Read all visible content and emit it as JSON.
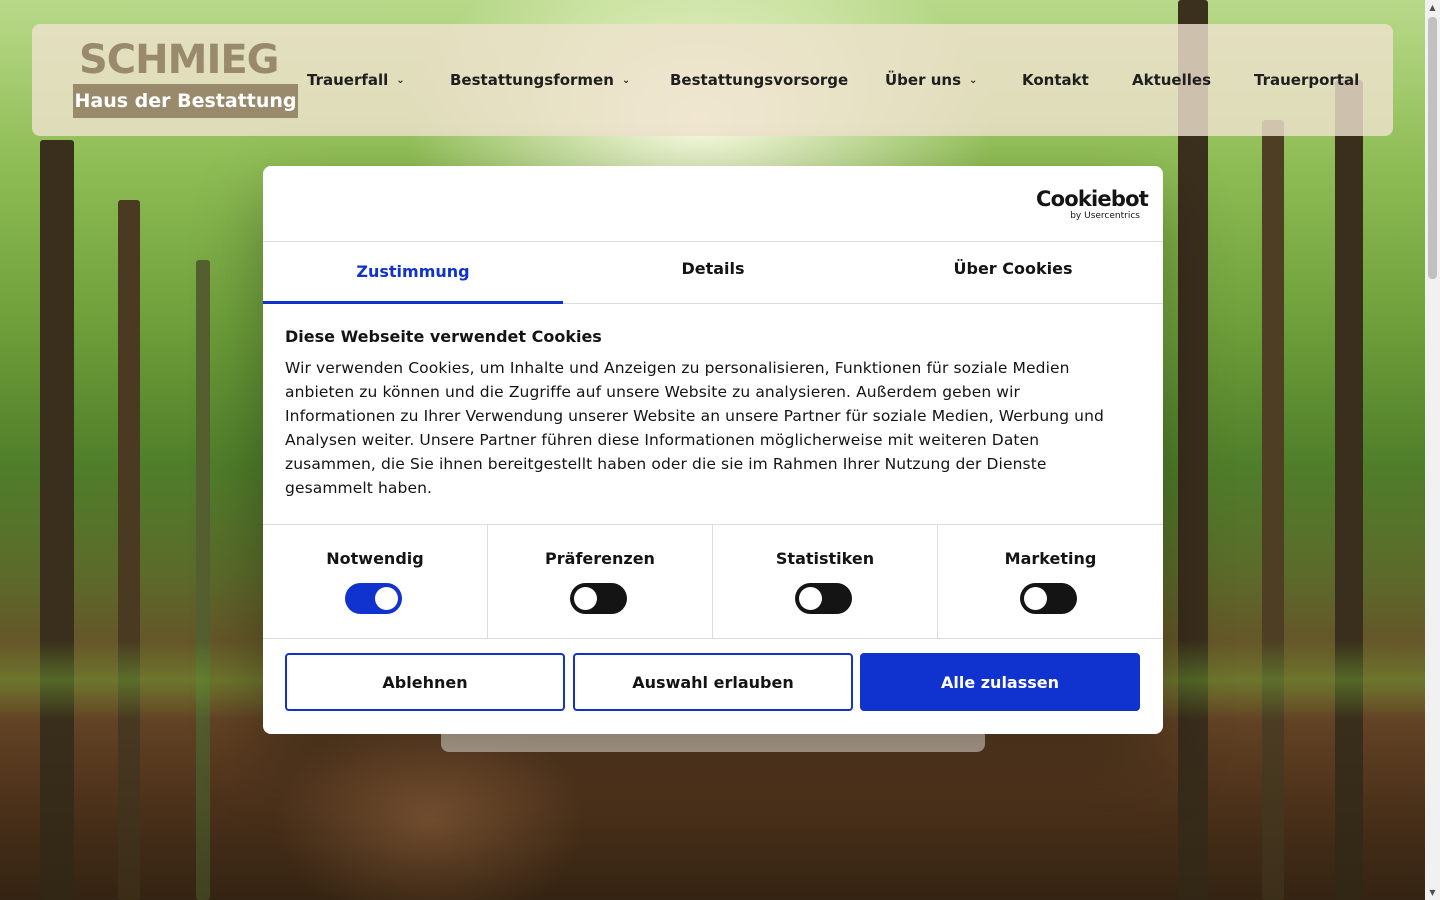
{
  "brand": {
    "name_top": "SCHMIEG",
    "name_bottom": "Haus der Bestattung",
    "color": "#9a8a6c"
  },
  "nav": {
    "items": [
      {
        "label": "Trauerfall",
        "has_dropdown": true
      },
      {
        "label": "Bestattungsformen",
        "has_dropdown": true
      },
      {
        "label": "Bestattungsvorsorge",
        "has_dropdown": false
      },
      {
        "label": "Über uns",
        "has_dropdown": true
      },
      {
        "label": "Kontakt",
        "has_dropdown": false
      },
      {
        "label": "Aktuelles",
        "has_dropdown": false
      },
      {
        "label": "Trauerportal",
        "has_dropdown": false
      }
    ],
    "chevron_icon": "chevron-down-icon"
  },
  "cookie_dialog": {
    "provider": {
      "name": "Cookiebot",
      "sub": "by Usercentrics"
    },
    "tabs": [
      {
        "label": "Zustimmung",
        "active": true
      },
      {
        "label": "Details",
        "active": false
      },
      {
        "label": "Über Cookies",
        "active": false
      }
    ],
    "title": "Diese Webseite verwendet Cookies",
    "text": "Wir verwenden Cookies, um Inhalte und Anzeigen zu personalisieren, Funktionen für soziale Medien anbieten zu können und die Zugriffe auf unsere Website zu analysieren. Außerdem geben wir Informationen zu Ihrer Verwendung unserer Website an unsere Partner für soziale Medien, Werbung und Analysen weiter. Unsere Partner führen diese Informationen möglicherweise mit weiteren Daten zusammen, die Sie ihnen bereitgestellt haben oder die sie im Rahmen Ihrer Nutzung der Dienste gesammelt haben.",
    "categories": [
      {
        "label": "Notwendig",
        "enabled": true
      },
      {
        "label": "Präferenzen",
        "enabled": false
      },
      {
        "label": "Statistiken",
        "enabled": false
      },
      {
        "label": "Marketing",
        "enabled": false
      }
    ],
    "buttons": {
      "reject": "Ablehnen",
      "allow_selection": "Auswahl erlauben",
      "allow_all": "Alle zulassen"
    },
    "accent_color": "#1032cf"
  }
}
